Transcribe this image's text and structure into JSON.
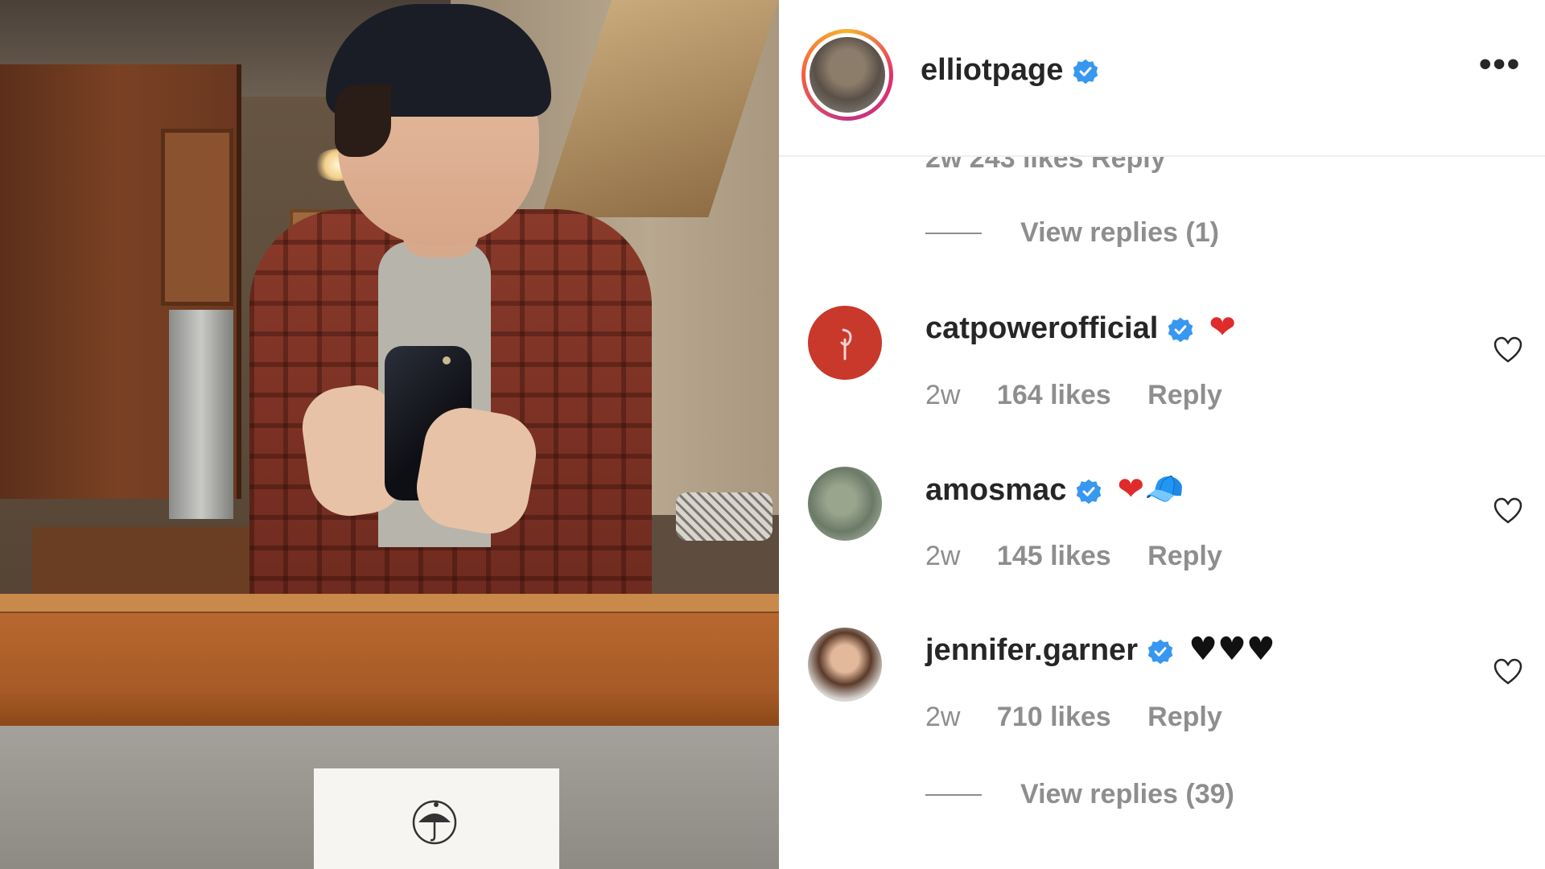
{
  "post": {
    "username": "elliotpage",
    "more_label": "•••",
    "partial_meta": "2w   243 likes   Reply"
  },
  "comments_top_replies": "View replies (1)",
  "comments": [
    {
      "username": "catpowerofficial",
      "emoji": "❤",
      "time": "2w",
      "likes": "164 likes",
      "reply": "Reply"
    },
    {
      "username": "amosmac",
      "emoji": "❤🧢",
      "time": "2w",
      "likes": "145 likes",
      "reply": "Reply"
    },
    {
      "username": "jennifer.garner",
      "emoji": "♥♥♥",
      "time": "2w",
      "likes": "710 likes",
      "reply": "Reply"
    }
  ],
  "comments_bottom_replies": "View replies (39)",
  "colors": {
    "verified": "#3897f0",
    "text": "#262626",
    "muted": "#8e8e8e",
    "heart": "#e02b2b"
  },
  "icons": [
    "verified-badge-icon",
    "more-options-icon",
    "like-heart-icon"
  ]
}
